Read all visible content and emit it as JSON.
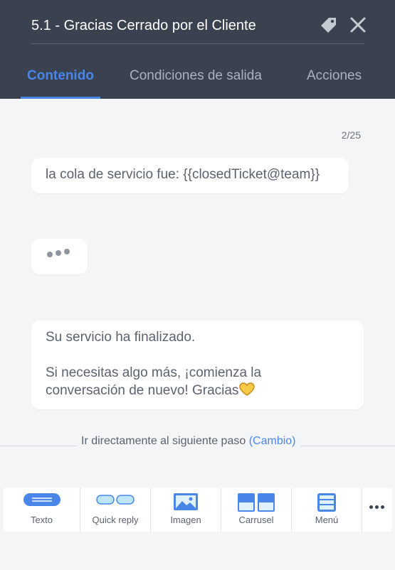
{
  "header": {
    "title": "5.1 - Gracias Cerrado por el Cliente",
    "tabs": [
      {
        "label": "Contenido",
        "active": true
      },
      {
        "label": "Condiciones de salida",
        "active": false
      },
      {
        "label": "Acciones",
        "active": false
      }
    ],
    "icons": {
      "tag": "tag-icon",
      "close": "close-icon"
    }
  },
  "main": {
    "counter": "2/25",
    "messages": [
      {
        "lines": [
          "la cola de servicio fue: {{closedTicket@team}}"
        ]
      },
      {
        "typing": true,
        "icon": "typing-indicator-icon"
      },
      {
        "lines": [
          "Su servicio ha finalizado.",
          "Si necesitas algo más, ¡comienza la",
          "conversación de nuevo! Gracias"
        ],
        "emoji": "yellow-heart"
      }
    ]
  },
  "footer": {
    "next_step_text": "Ir directamente al siguiente paso",
    "next_step_link": "(Cambio)"
  },
  "toolbar": {
    "items": [
      {
        "label": "Texto",
        "icon": "text-icon"
      },
      {
        "label": "Quick reply",
        "icon": "quick-reply-icon"
      },
      {
        "label": "Imagen",
        "icon": "image-icon"
      },
      {
        "label": "Carrusel",
        "icon": "carousel-icon"
      },
      {
        "label": "Menú",
        "icon": "menu-icon"
      }
    ],
    "more_icon": "more-options-icon"
  },
  "colors": {
    "header_bg": "#3a4250",
    "accent": "#4a86e8",
    "page_bg": "#f4f5f7"
  }
}
